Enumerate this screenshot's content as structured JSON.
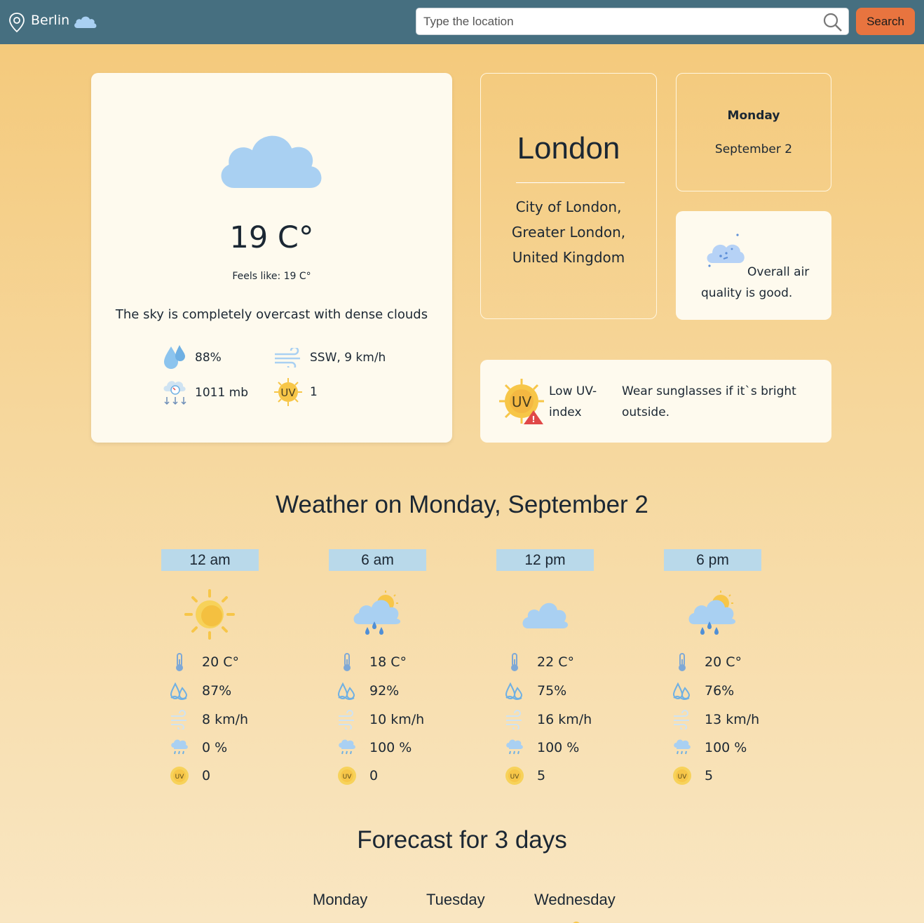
{
  "header": {
    "city": "Berlin",
    "location_icon": "map-pin-icon",
    "weather_icon": "cloud-icon",
    "search_placeholder": "Type the location",
    "search_button": "Search"
  },
  "current": {
    "icon": "cloud-icon",
    "temperature": "19 C°",
    "feels_like": "Feels like: 19 C°",
    "description": "The sky is completely overcast with dense clouds",
    "humidity": "88%",
    "wind": "SSW, 9 km/h",
    "pressure": "1011 mb",
    "uv": "1"
  },
  "location": {
    "city": "London",
    "region_line1": "City of London,",
    "region_line2": "Greater London,",
    "region_line3": "United Kingdom"
  },
  "date": {
    "weekday": "Monday",
    "date": "September 2"
  },
  "air_quality": {
    "text": "Overall air quality is good.",
    "icon": "air-quality-icon"
  },
  "uv_info": {
    "label": "Low UV-index",
    "advice": "Wear sunglasses if it`s bright outside."
  },
  "day_section": {
    "heading": "Weather on Monday, September 2",
    "hours": [
      {
        "label": "12 am",
        "icon": "sun-icon",
        "temp": "20 C°",
        "humidity": "87%",
        "wind": "8 km/h",
        "precip": "0 %",
        "uv": "0"
      },
      {
        "label": "6 am",
        "icon": "sun-rain-cloud-icon",
        "temp": "18 C°",
        "humidity": "92%",
        "wind": "10 km/h",
        "precip": "100 %",
        "uv": "0"
      },
      {
        "label": "12 pm",
        "icon": "cloud-icon",
        "temp": "22 C°",
        "humidity": "75%",
        "wind": "16 km/h",
        "precip": "100 %",
        "uv": "5"
      },
      {
        "label": "6 pm",
        "icon": "sun-rain-cloud-icon",
        "temp": "20 C°",
        "humidity": "76%",
        "wind": "13 km/h",
        "precip": "100 %",
        "uv": "5"
      }
    ]
  },
  "forecast": {
    "heading": "Forecast for 3 days",
    "days": [
      "Monday",
      "Tuesday",
      "Wednesday"
    ]
  },
  "colors": {
    "header_bg": "#466f80",
    "search_button": "#e8743f",
    "card_bg": "#fefaee",
    "hour_label_bg": "#b9d9ea",
    "cloud": "#a9d0f2",
    "sun": "#f7c648"
  }
}
